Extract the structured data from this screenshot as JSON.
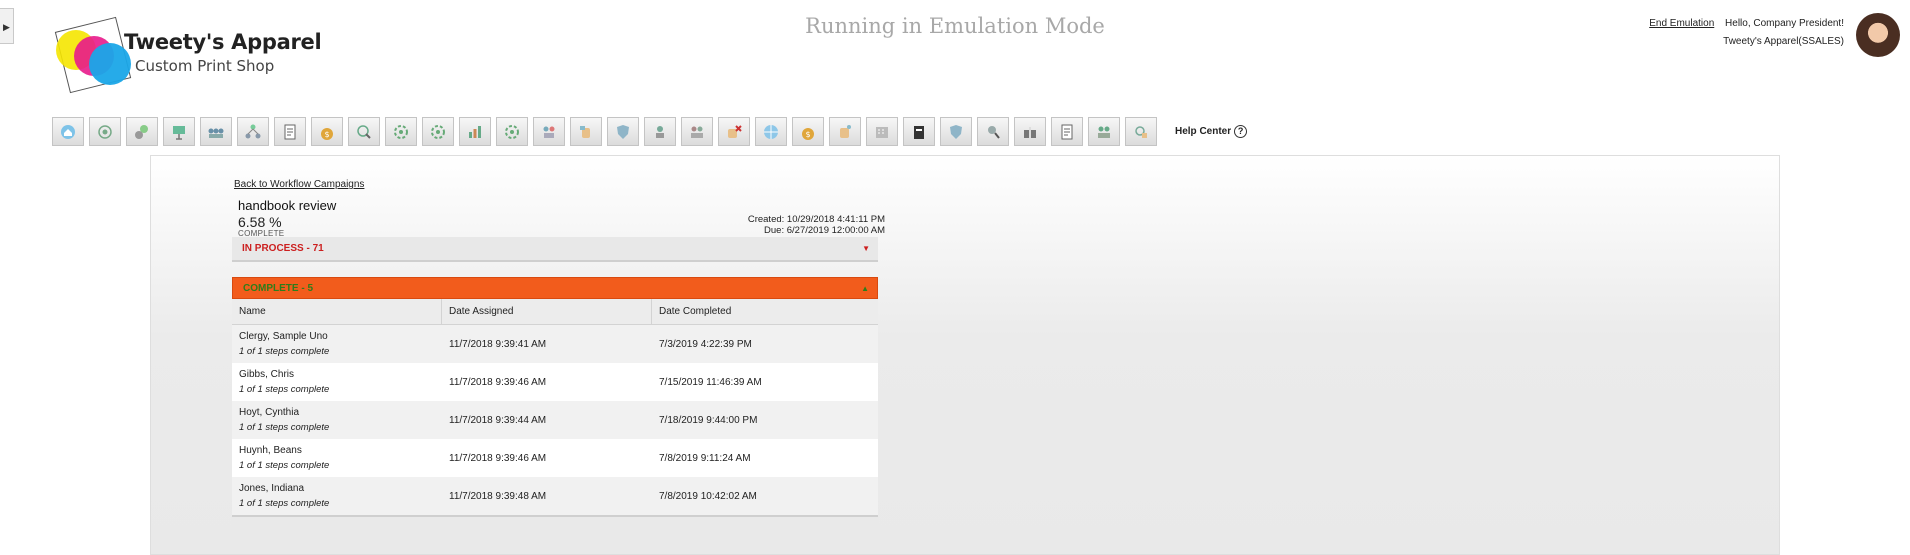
{
  "header": {
    "brand_name": "Tweety's Apparel",
    "brand_sub": "Custom Print Shop",
    "emulation_title": "Running in Emulation Mode",
    "end_emulation": "End Emulation",
    "greeting": "Hello, Company President!",
    "company": "Tweety's Apparel(SSALES)"
  },
  "toolbar": {
    "icons": [
      "home-icon",
      "target-icon",
      "dollar-bubble-icon",
      "presentation-icon",
      "team-icon",
      "org-chart-icon",
      "document-icon",
      "money-bag-icon",
      "chat-magnify-icon",
      "gear-icon",
      "gear-icon",
      "chart-icon",
      "gear-icon",
      "people-swap-icon",
      "hand-icon",
      "shield-icon",
      "person-gear-icon",
      "people-gear-icon",
      "hand-cancel-icon",
      "globe-icon",
      "money-bag-icon",
      "hand-point-icon",
      "building-icon",
      "clipboard-icon",
      "shield-icon",
      "person-search-icon",
      "gift-icon",
      "document-icon",
      "people-icon",
      "hand-search-icon"
    ],
    "help_label": "Help Center",
    "help_glyph": "?"
  },
  "campaign": {
    "back_link": "Back to Workflow Campaigns",
    "title": "handbook review",
    "percent": "6.58 %",
    "percent_label": "COMPLETE",
    "created": "Created: 10/29/2018 4:41:11 PM",
    "due": "Due: 6/27/2019 12:00:00 AM",
    "in_process_label": "IN PROCESS - 71",
    "in_process_arrow": "▼",
    "complete_label": "COMPLETE - 5",
    "complete_arrow": "▲"
  },
  "table": {
    "columns": [
      "Name",
      "Date Assigned",
      "Date Completed"
    ],
    "rows": [
      {
        "name": "Clergy, Sample Uno",
        "steps": "1 of 1 steps complete",
        "assigned": "11/7/2018 9:39:41 AM",
        "completed": "7/3/2019 4:22:39 PM"
      },
      {
        "name": "Gibbs, Chris",
        "steps": "1 of 1 steps complete",
        "assigned": "11/7/2018 9:39:46 AM",
        "completed": "7/15/2019 11:46:39 AM"
      },
      {
        "name": "Hoyt, Cynthia",
        "steps": "1 of 1 steps complete",
        "assigned": "11/7/2018 9:39:44 AM",
        "completed": "7/18/2019 9:44:00 PM"
      },
      {
        "name": "Huynh, Beans",
        "steps": "1 of 1 steps complete",
        "assigned": "11/7/2018 9:39:46 AM",
        "completed": "7/8/2019 9:11:24 AM"
      },
      {
        "name": "Jones, Indiana",
        "steps": "1 of 1 steps complete",
        "assigned": "11/7/2018 9:39:48 AM",
        "completed": "7/8/2019 10:42:02 AM"
      }
    ]
  },
  "colors": {
    "complete_bar": "#f25c1c",
    "complete_text": "#2e7d1a",
    "in_process_text": "#cc1f1f",
    "emulation_title": "#a8a8a8"
  }
}
